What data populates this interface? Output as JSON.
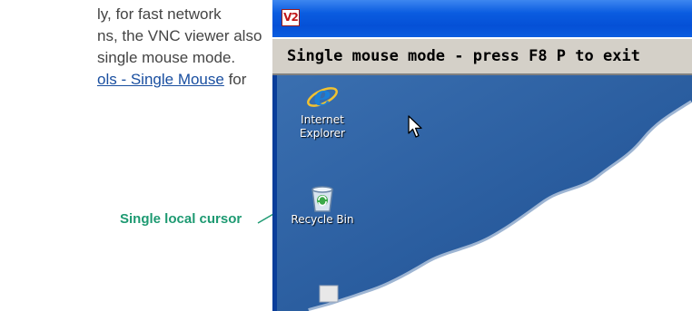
{
  "document": {
    "lines": [
      "ly, for fast network",
      "ns, the VNC viewer also",
      " single mouse mode."
    ],
    "link_text": "ols - Single Mouse",
    "link_suffix": " for"
  },
  "callout": {
    "label": "Single local cursor"
  },
  "vnc_window": {
    "app_icon_text": "V2",
    "banner_text": "Single mouse mode - press F8 P to exit"
  },
  "desktop": {
    "icons": [
      {
        "name": "ie-icon",
        "label": "Internet\nExplorer"
      },
      {
        "name": "recycle-bin-icon",
        "label": "Recycle Bin"
      }
    ]
  },
  "colors": {
    "link": "#1a4fa0",
    "callout": "#1e9a72",
    "titlebar": "#0a5ce0",
    "desktop_blue": "#2f63a4"
  }
}
